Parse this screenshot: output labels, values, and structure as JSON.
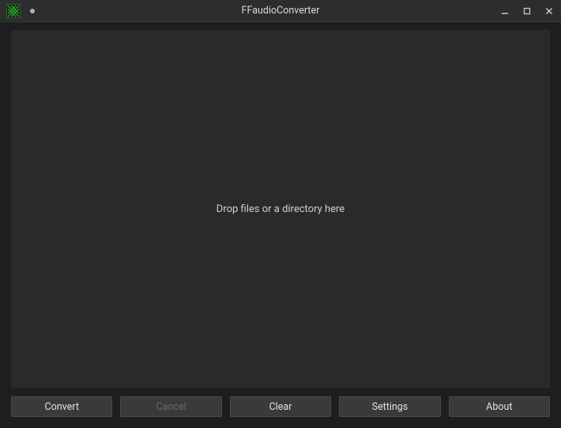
{
  "window": {
    "title": "FFaudioConverter"
  },
  "main": {
    "drop_hint": "Drop files or a directory here"
  },
  "buttons": {
    "convert": "Convert",
    "cancel": "Cancel",
    "clear": "Clear",
    "settings": "Settings",
    "about": "About"
  }
}
